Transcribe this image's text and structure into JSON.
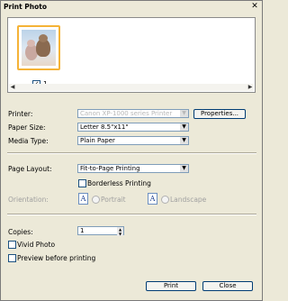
{
  "window": {
    "title": "Print Photo",
    "close_glyph": "✕"
  },
  "preview": {
    "thumbnail_count": "1",
    "thumbnail_checked": true,
    "scroll_left": "◀",
    "scroll_right": "▶"
  },
  "fields": {
    "printer": {
      "label": "Printer:",
      "value": "Canon XP-1000 series Printer",
      "button": "Properties..."
    },
    "paper_size": {
      "label": "Paper Size:",
      "value": "Letter 8.5\"x11\""
    },
    "media_type": {
      "label": "Media Type:",
      "value": "Plain Paper"
    },
    "page_layout": {
      "label": "Page Layout:",
      "value": "Fit-to-Page Printing"
    },
    "borderless": {
      "label": "Borderless Printing",
      "checked": false
    },
    "orientation": {
      "label": "Orientation:",
      "portrait": "Portrait",
      "landscape": "Landscape",
      "icon_glyph": "A"
    },
    "copies": {
      "label": "Copies:",
      "value": "1"
    },
    "vivid_photo": {
      "label": "Vivid Photo",
      "checked": false
    },
    "preview_before": {
      "label": "Preview before printing",
      "checked": false
    }
  },
  "buttons": {
    "print": "Print",
    "close": "Close"
  },
  "dropdown_arrow": "▼"
}
